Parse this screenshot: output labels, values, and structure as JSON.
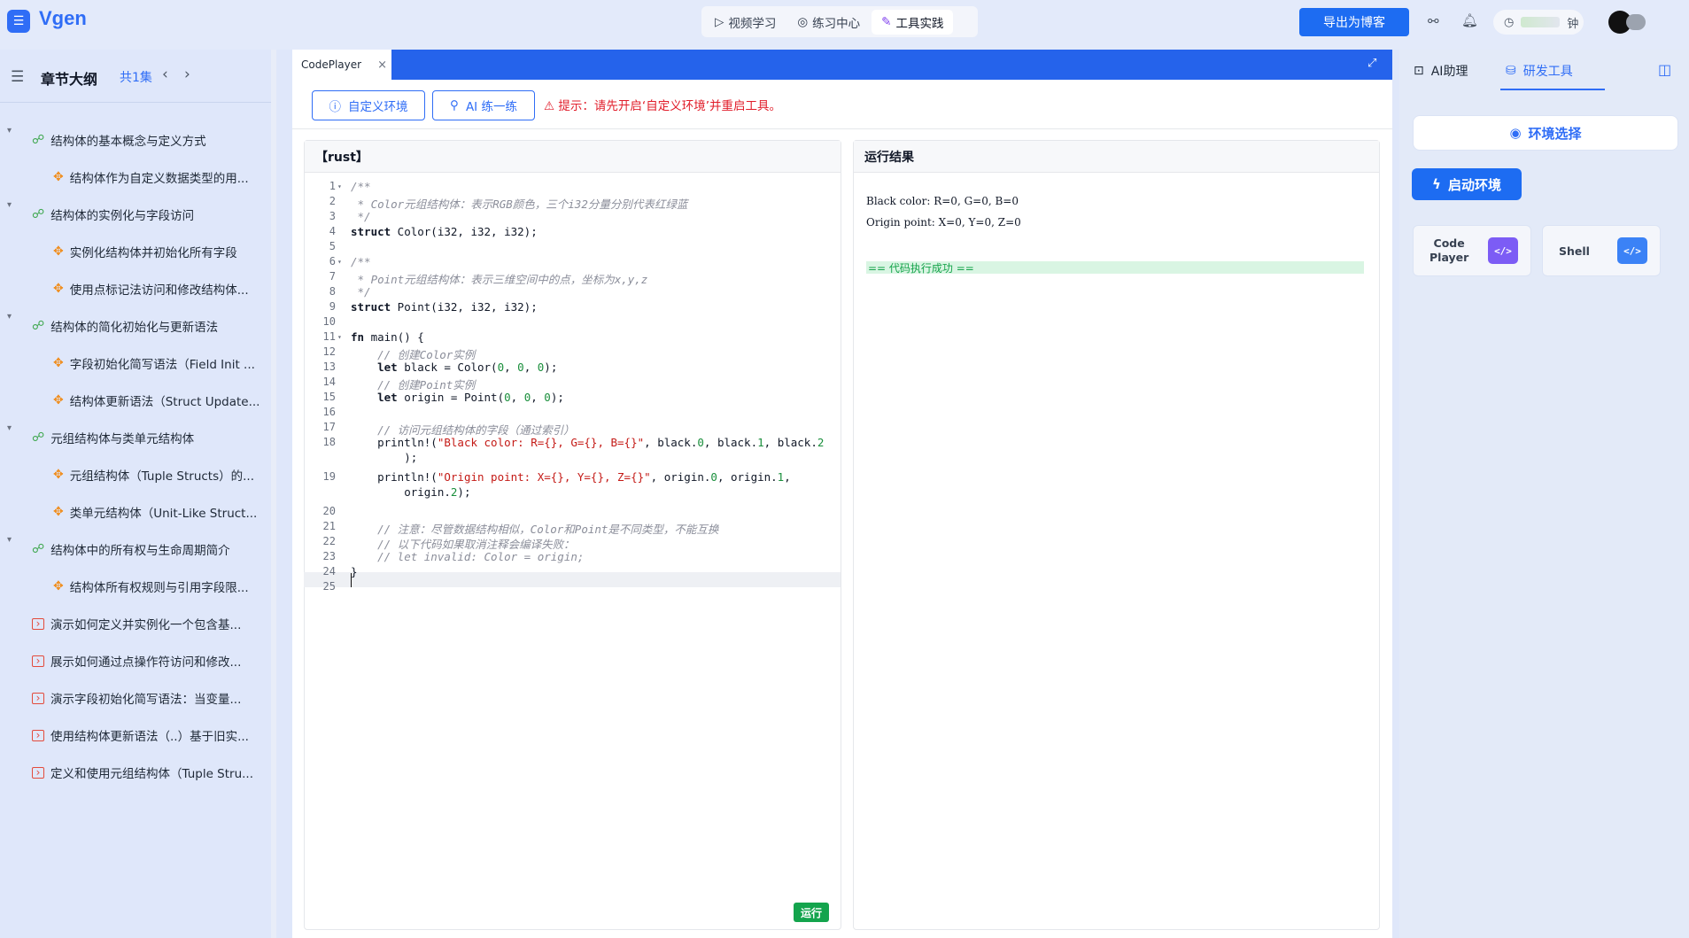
{
  "app": {
    "title": "Vgen"
  },
  "nav": {
    "tabs": [
      {
        "label": "视频学习",
        "icon": "play-icon"
      },
      {
        "label": "练习中心",
        "icon": "target-icon"
      },
      {
        "label": "工具实践",
        "icon": "wrench-icon"
      }
    ],
    "active": "工具实践"
  },
  "header": {
    "export_label": "导出为博客",
    "timer_suffix": "钟"
  },
  "sidebar": {
    "title": "章节大纲",
    "count": "共1集",
    "items": [
      {
        "level": 0,
        "type": "section",
        "label": "结构体的基本概念与定义方式"
      },
      {
        "level": 1,
        "type": "sub",
        "label": "结构体作为自定义数据类型的用..."
      },
      {
        "level": 0,
        "type": "section",
        "label": "结构体的实例化与字段访问"
      },
      {
        "level": 1,
        "type": "sub",
        "label": "实例化结构体并初始化所有字段"
      },
      {
        "level": 1,
        "type": "sub",
        "label": "使用点标记法访问和修改结构体..."
      },
      {
        "level": 0,
        "type": "section",
        "label": "结构体的简化初始化与更新语法"
      },
      {
        "level": 1,
        "type": "sub",
        "label": "字段初始化简写语法（Field Init ..."
      },
      {
        "level": 1,
        "type": "sub",
        "label": "结构体更新语法（Struct Update..."
      },
      {
        "level": 0,
        "type": "section",
        "label": "元组结构体与类单元结构体"
      },
      {
        "level": 1,
        "type": "sub",
        "label": "元组结构体（Tuple Structs）的..."
      },
      {
        "level": 1,
        "type": "sub",
        "label": "类单元结构体（Unit-Like Struct..."
      },
      {
        "level": 0,
        "type": "section",
        "label": "结构体中的所有权与生命周期简介"
      },
      {
        "level": 1,
        "type": "sub",
        "label": "结构体所有权规则与引用字段限..."
      },
      {
        "level": 0,
        "type": "code",
        "label": "演示如何定义并实例化一个包含基..."
      },
      {
        "level": 0,
        "type": "code",
        "label": "展示如何通过点操作符访问和修改..."
      },
      {
        "level": 0,
        "type": "code",
        "label": "演示字段初始化简写语法：当变量..."
      },
      {
        "level": 0,
        "type": "code",
        "label": "使用结构体更新语法（..）基于旧实..."
      },
      {
        "level": 0,
        "type": "code",
        "label": "定义和使用元组结构体（Tuple Stru..."
      }
    ]
  },
  "main": {
    "tab_label": "CodePlayer",
    "custom_env_label": "自定义环境",
    "ai_practice_label": "AI 练一练",
    "warning": "提示：请先开启‘自定义环境’并重启工具。",
    "editor_title": "【rust】",
    "output_title": "运行结果",
    "run_label": "运行",
    "code_lines": [
      {
        "n": "1",
        "fold": true,
        "t": "/**",
        "c": true
      },
      {
        "n": "2",
        "t": " * Color元组结构体：表示RGB颜色，三个i32分量分别代表红绿蓝",
        "c": true
      },
      {
        "n": "3",
        "t": " */",
        "c": true
      },
      {
        "n": "4",
        "t": "struct Color(i32, i32, i32);"
      },
      {
        "n": "5",
        "t": ""
      },
      {
        "n": "6",
        "fold": true,
        "t": "/**",
        "c": true
      },
      {
        "n": "7",
        "t": " * Point元组结构体：表示三维空间中的点，坐标为x,y,z",
        "c": true
      },
      {
        "n": "8",
        "t": " */",
        "c": true
      },
      {
        "n": "9",
        "t": "struct Point(i32, i32, i32);"
      },
      {
        "n": "10",
        "t": ""
      },
      {
        "n": "11",
        "fold": true,
        "t": "fn main() {"
      },
      {
        "n": "12",
        "t": "    // 创建Color实例",
        "c": true
      },
      {
        "n": "13",
        "t": "    let black = Color(0, 0, 0);"
      },
      {
        "n": "14",
        "t": "    // 创建Point实例",
        "c": true
      },
      {
        "n": "15",
        "t": "    let origin = Point(0, 0, 0);"
      },
      {
        "n": "16",
        "t": ""
      },
      {
        "n": "17",
        "t": "    // 访问元组结构体的字段（通过索引）",
        "c": true
      },
      {
        "n": "18",
        "t": "    println!(\"Black color: R={}, G={}, B={}\", black.0, black.1, black.2"
      },
      {
        "n": "",
        "t": "        );"
      },
      {
        "n": "19",
        "t": "    println!(\"Origin point: X={}, Y={}, Z={}\", origin.0, origin.1,"
      },
      {
        "n": "",
        "t": "        origin.2);"
      },
      {
        "n": "20",
        "t": ""
      },
      {
        "n": "21",
        "t": "    // 注意：尽管数据结构相似，Color和Point是不同类型，不能互换",
        "c": true
      },
      {
        "n": "22",
        "t": "    // 以下代码如果取消注释会编译失败：",
        "c": true
      },
      {
        "n": "23",
        "t": "    // let invalid: Color = origin;",
        "c": true
      },
      {
        "n": "24",
        "t": "}"
      },
      {
        "n": "25",
        "t": ""
      }
    ],
    "output_lines": [
      "Black color: R=0, G=0, B=0",
      "Origin point: X=0, Y=0, Z=0"
    ],
    "success_text": "== 代码执行成功 =="
  },
  "right": {
    "tab_ai": "AI助理",
    "tab_dev": "研发工具",
    "env_select_label": "环境选择",
    "start_env_label": "启动环境",
    "tools": [
      {
        "label": "Code Player",
        "label_line1": "Code",
        "label_line2": "Player",
        "icon": "code-icon",
        "color": "#7c5cf5"
      },
      {
        "label": "Shell",
        "icon": "terminal-icon",
        "color": "#3b82f6"
      }
    ]
  },
  "colors": {
    "accent": "#2f6df6",
    "success": "#14a44d",
    "warning": "#e11d2a"
  }
}
